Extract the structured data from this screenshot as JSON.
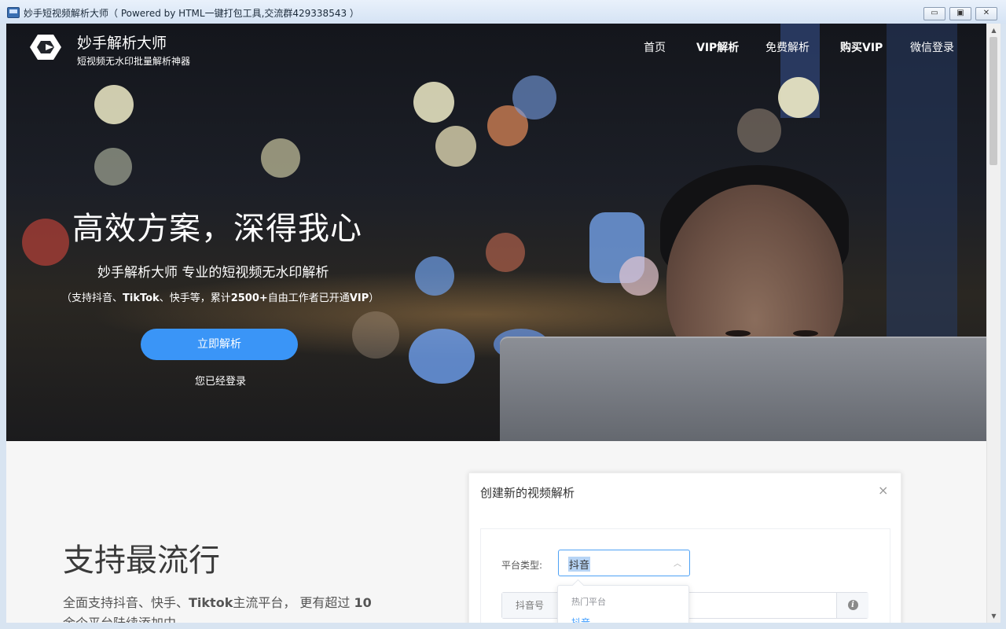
{
  "window": {
    "title": "妙手短视频解析大师（ Powered by HTML一键打包工具,交流群429338543 ）",
    "min_glyph": "▭",
    "max_glyph": "▣",
    "close_glyph": "✕"
  },
  "brand": {
    "name": "妙手解析大师",
    "tagline": "短视频无水印批量解析神器"
  },
  "nav": {
    "items": [
      "首页",
      "VIP解析",
      "免费解析",
      "购买VIP",
      "微信登录"
    ]
  },
  "hero": {
    "title": "高效方案，深得我心",
    "subtitle": "妙手解析大师 专业的短视频无水印解析",
    "note_start": "（支持抖音、",
    "note_bold1": "TikTok",
    "note_mid": "、快手等，累计",
    "note_bold2": "2500+",
    "note_end": "自由工作者已开通",
    "note_bold3": "VIP",
    "note_close": "）",
    "cta": "立即解析",
    "login_status": "您已经登录"
  },
  "section": {
    "heading": "支持最流行",
    "desc_start": "全面支持抖音、快手、",
    "desc_bold1": "Tiktok",
    "desc_mid": "主流平台， 更有超过 ",
    "desc_bold2": "10",
    "desc_end": "余个平台陆续添加中"
  },
  "dialog": {
    "title": "创建新的视频解析",
    "close": "×",
    "platform_label": "平台类型:",
    "platform_value": "抖音",
    "account_prefix": "抖音号",
    "dropdown_group": "热门平台",
    "dropdown_option": "抖音"
  },
  "colors": {
    "accent": "#3a95f7",
    "select_border": "#4ea2f5",
    "option_active": "#409eff"
  }
}
